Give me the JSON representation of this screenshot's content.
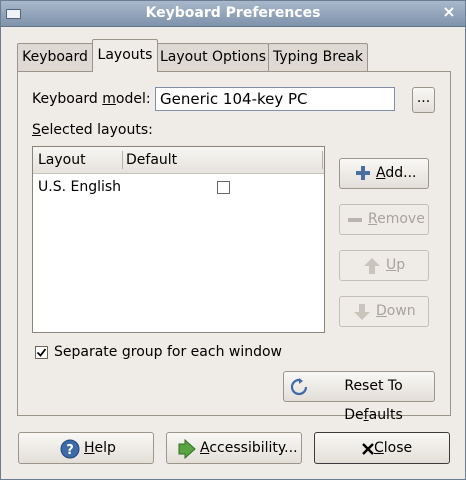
{
  "window": {
    "title": "Keyboard Preferences"
  },
  "tabs": [
    {
      "label": "Keyboard",
      "active": false
    },
    {
      "label": "Layouts",
      "active": true
    },
    {
      "label": "Layout Options",
      "active": false
    },
    {
      "label": "Typing Break",
      "active": false
    }
  ],
  "layouts": {
    "model_label_pre": "Keyboard ",
    "model_label_mnemonic": "m",
    "model_label_post": "odel:",
    "model_value": "Generic 104-key PC",
    "model_browse_label": "...",
    "selected_label_mnemonic": "S",
    "selected_label_rest": "elected layouts:",
    "columns": [
      "Layout",
      "Default"
    ],
    "rows": [
      {
        "layout": "U.S. English",
        "default": false
      }
    ],
    "add_label_mnemonic": "A",
    "add_label_rest": "dd...",
    "remove_label_mnemonic": "R",
    "remove_label_rest": "emove",
    "up_label_mnemonic": "U",
    "up_label_rest": "p",
    "down_label_mnemonic": "D",
    "down_label_rest": "own",
    "separate_group": {
      "checked": true,
      "label_pre": "Separate ",
      "label_mnemonic": "g",
      "label_post": "roup for each window"
    },
    "reset_label_pre": "Reset To De",
    "reset_label_mnemonic": "f",
    "reset_label_post": "aults"
  },
  "footer": {
    "help_label_mnemonic": "H",
    "help_label_rest": "elp",
    "accessibility_label_mnemonic": "A",
    "accessibility_label_rest": "ccessibility...",
    "close_label_mnemonic": "C",
    "close_label_rest": "lose"
  },
  "icons": {
    "window_menu": "window-menu-icon",
    "window_close": "close-icon",
    "add": "plus-icon",
    "remove": "minus-icon",
    "up": "arrow-up-icon",
    "down": "arrow-down-icon",
    "reset": "refresh-icon",
    "help": "help-icon",
    "accessibility": "accessibility-icon",
    "close": "x-icon"
  },
  "colors": {
    "titlebar": "#8fa2b9",
    "window_bg": "#efebe7",
    "accent": "#4a6fa5"
  }
}
